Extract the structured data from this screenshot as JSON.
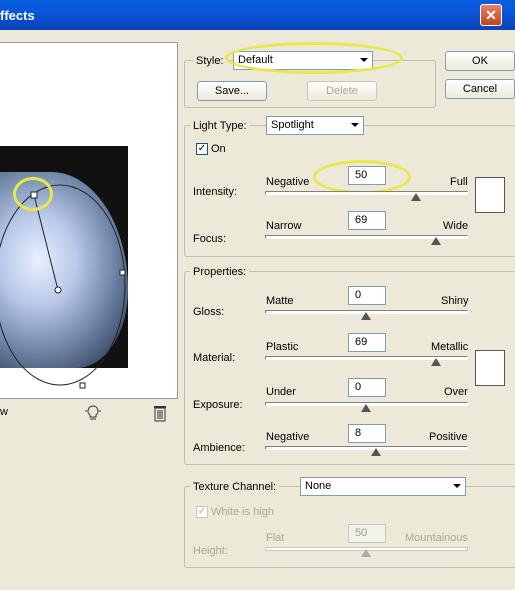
{
  "window": {
    "title": "ffects",
    "close_glyph": "✕"
  },
  "style": {
    "label": "Style:",
    "value": "Default",
    "save_label": "Save...",
    "delete_label": "Delete"
  },
  "buttons": {
    "ok": "OK",
    "cancel": "Cancel"
  },
  "light_type": {
    "label": "Light Type:",
    "value": "Spotlight",
    "on_label": "On",
    "on_checked": true,
    "intensity": {
      "label": "Intensity:",
      "min_label": "Negative",
      "max_label": "Full",
      "value": "50"
    },
    "focus": {
      "label": "Focus:",
      "min_label": "Narrow",
      "max_label": "Wide",
      "value": "69"
    }
  },
  "properties": {
    "label": "Properties:",
    "gloss": {
      "label": "Gloss:",
      "min_label": "Matte",
      "max_label": "Shiny",
      "value": "0"
    },
    "material": {
      "label": "Material:",
      "min_label": "Plastic",
      "max_label": "Metallic",
      "value": "69"
    },
    "exposure": {
      "label": "Exposure:",
      "min_label": "Under",
      "max_label": "Over",
      "value": "0"
    },
    "ambience": {
      "label": "Ambience:",
      "min_label": "Negative",
      "max_label": "Positive",
      "value": "8"
    }
  },
  "texture": {
    "label": "Texture Channel:",
    "value": "None",
    "white_is_high_label": "White is high",
    "height": {
      "label": "Height:",
      "min_label": "Flat",
      "max_label": "Mountainous",
      "value": "50"
    }
  },
  "preview": {
    "label_fragment": "w"
  },
  "colors": {
    "titlebar": "#0a5ee0",
    "highlight": "#e8e84a",
    "dialog_bg": "#ece9d8"
  }
}
